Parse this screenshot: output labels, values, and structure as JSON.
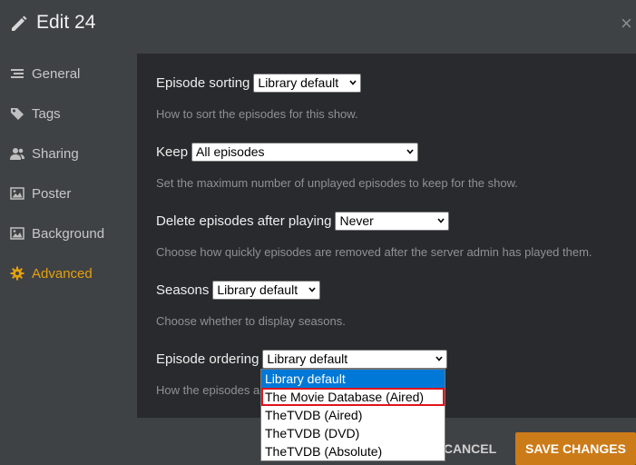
{
  "header": {
    "title": "Edit 24",
    "close_glyph": "×"
  },
  "sidebar": {
    "items": [
      {
        "label": "General",
        "icon": "list-icon",
        "active": false
      },
      {
        "label": "Tags",
        "icon": "tag-icon",
        "active": false
      },
      {
        "label": "Sharing",
        "icon": "users-icon",
        "active": false
      },
      {
        "label": "Poster",
        "icon": "image-icon",
        "active": false
      },
      {
        "label": "Background",
        "icon": "image-icon",
        "active": false
      },
      {
        "label": "Advanced",
        "icon": "gear-icon",
        "active": true
      }
    ]
  },
  "settings": {
    "episode_sorting": {
      "label": "Episode sorting",
      "value": "Library default",
      "help": "How to sort the episodes for this show."
    },
    "keep": {
      "label": "Keep",
      "value": "All episodes",
      "help": "Set the maximum number of unplayed episodes to keep for the show."
    },
    "delete_after": {
      "label": "Delete episodes after playing",
      "value": "Never",
      "help": "Choose how quickly episodes are removed after the server admin has played them."
    },
    "seasons": {
      "label": "Seasons",
      "value": "Library default",
      "help": "Choose whether to display seasons."
    },
    "episode_ordering": {
      "label": "Episode ordering",
      "value": "Library default",
      "help": "How the episodes a",
      "options": [
        "Library default",
        "The Movie Database (Aired)",
        "TheTVDB (Aired)",
        "TheTVDB (DVD)",
        "TheTVDB (Absolute)"
      ]
    }
  },
  "footer": {
    "cancel_label": "CANCEL",
    "save_label": "SAVE CHANGES"
  },
  "colors": {
    "accent": "#e5a00d",
    "save_button": "#cc7b19",
    "highlight_box": "#e0131d",
    "selected_option": "#0078d7"
  }
}
